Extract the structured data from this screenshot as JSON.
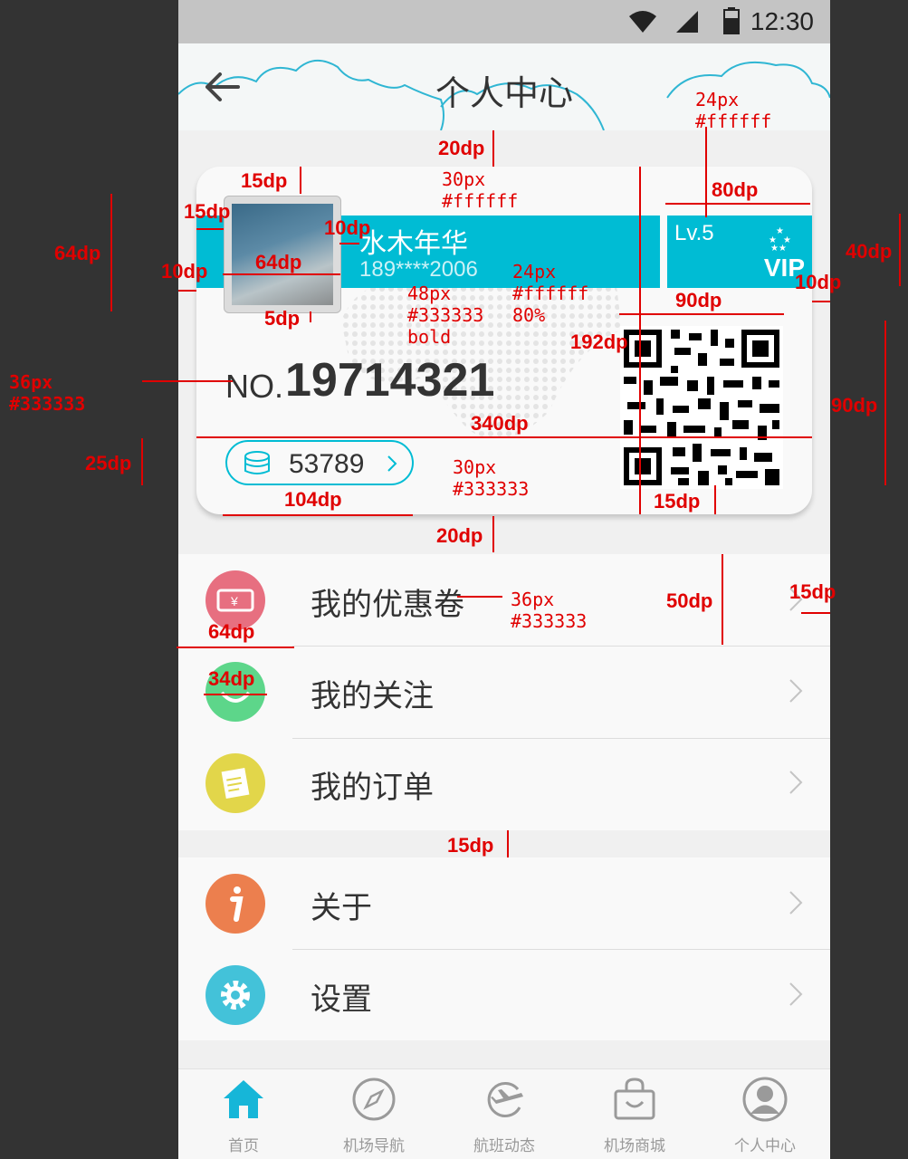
{
  "status_bar": {
    "time": "12:30"
  },
  "header": {
    "title": "个人中心"
  },
  "card": {
    "user_name": "水木年华",
    "phone": "189****2006",
    "level": "Lv.5",
    "vip_label": "VIP",
    "number_prefix": "NO.",
    "number_value": "19714321",
    "coins": "53789"
  },
  "menu_group_1": [
    {
      "label": "我的优惠卷",
      "icon": "coupon-icon",
      "color": "#e76f80"
    },
    {
      "label": "我的关注",
      "icon": "follow-icon",
      "color": "#5dd68a"
    },
    {
      "label": "我的订单",
      "icon": "order-icon",
      "color": "#e2d64a"
    }
  ],
  "menu_group_2": [
    {
      "label": "关于",
      "icon": "info-icon",
      "color": "#ec7f4e"
    },
    {
      "label": "设置",
      "icon": "gear-icon",
      "color": "#43c2d9"
    }
  ],
  "tabbar": [
    {
      "label": "首页",
      "icon": "home-icon",
      "active": true
    },
    {
      "label": "机场导航",
      "icon": "compass-icon",
      "active": false
    },
    {
      "label": "航班动态",
      "icon": "flight-icon",
      "active": false
    },
    {
      "label": "机场商城",
      "icon": "shop-icon",
      "active": false
    },
    {
      "label": "个人中心",
      "icon": "profile-icon",
      "active": false
    }
  ],
  "colors": {
    "accent": "#00bcd4",
    "annotation": "#e00000",
    "text": "#333333"
  },
  "annotations": {
    "a1": "24px\n#ffffff",
    "a2": "20dp",
    "a3": "15dp",
    "a4": "30px\n#ffffff",
    "a5": "80dp",
    "a6": "64dp",
    "a7": "15dp",
    "a8": "10dp",
    "a9": "40dp",
    "a10": "10dp",
    "a11": "64dp",
    "a12": "24px\n#ffffff\n80%",
    "a13": "10dp",
    "a14": "5dp",
    "a15": "48px\n#333333\nbold",
    "a16": "90dp",
    "a17": "192dp",
    "a18": "36px\n#333333",
    "a19": "90dp",
    "a20": "340dp",
    "a21": "25dp",
    "a22": "30px\n#333333",
    "a23": "104dp",
    "a24": "15dp",
    "a25": "20dp",
    "a26": "36px\n#333333",
    "a27": "50dp",
    "a28": "15dp",
    "a29": "64dp",
    "a30": "34dp",
    "a31": "15dp"
  }
}
